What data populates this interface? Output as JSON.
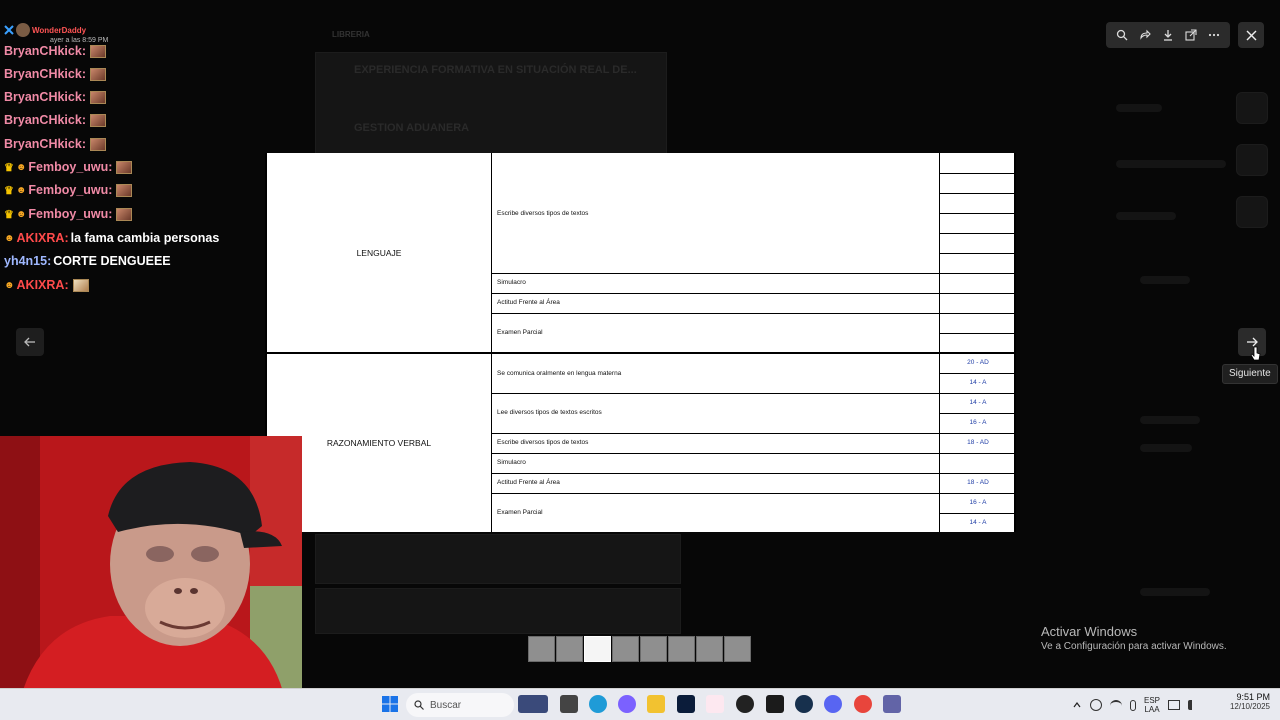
{
  "chat": {
    "header_name": "WonderDaddy",
    "header_time": "ayer a las 8:59 PM",
    "messages": [
      {
        "user": "BryanCHkick:",
        "text": "",
        "color": "pink"
      },
      {
        "user": "BryanCHkick:",
        "text": "",
        "color": "pink"
      },
      {
        "user": "BryanCHkick:",
        "text": "",
        "color": "pink"
      },
      {
        "user": "BryanCHkick:",
        "text": "",
        "color": "pink"
      },
      {
        "user": "BryanCHkick:",
        "text": "",
        "color": "pink"
      },
      {
        "user": "Femboy_uwu:",
        "text": "",
        "color": "pink"
      },
      {
        "user": "Femboy_uwu:",
        "text": "",
        "color": "pink"
      },
      {
        "user": "Femboy_uwu:",
        "text": "",
        "color": "pink"
      },
      {
        "user": "AKIXRA:",
        "text": "la fama cambia personas",
        "color": "red"
      },
      {
        "user": "yh4n15:",
        "text": "CORTE DENGUEEE",
        "color": "blue"
      },
      {
        "user": "AKIXRA:",
        "text": "",
        "color": "red"
      }
    ]
  },
  "viewer": {
    "next_tooltip": "Siguiente",
    "thumbnail_count": 8,
    "active_thumbnail": 3
  },
  "document": {
    "sections": [
      {
        "area": "LENGUAJE",
        "rows": [
          {
            "competency": "Escribe diversos tipos de textos",
            "grades": [
              "",
              "",
              "",
              "",
              "",
              ""
            ]
          },
          {
            "competency": "Simulacro",
            "grades": [
              ""
            ]
          },
          {
            "competency": "Actitud Frente al Área",
            "grades": [
              ""
            ]
          },
          {
            "competency": "Examen Parcial",
            "grades": [
              "",
              ""
            ]
          }
        ]
      },
      {
        "area": "RAZONAMIENTO VERBAL",
        "rows": [
          {
            "competency": "Se comunica oralmente en lengua materna",
            "grades": [
              "20 - AD",
              "14 - A"
            ]
          },
          {
            "competency": "Lee diversos tipos de textos escritos",
            "grades": [
              "14 - A",
              "16 - A"
            ]
          },
          {
            "competency": "Escribe diversos tipos de textos",
            "grades": [
              "18 - AD"
            ]
          },
          {
            "competency": "Simulacro",
            "grades": [
              ""
            ]
          },
          {
            "competency": "Actitud Frente al Área",
            "grades": [
              "18 - AD"
            ]
          },
          {
            "competency": "Examen Parcial",
            "grades": [
              "16 - A",
              "14 - A"
            ]
          }
        ]
      }
    ]
  },
  "background": {
    "card_title_1": "EXPERIENCIA FORMATIVA EN SITUACIÓN REAL DE...",
    "card_title_2": "GESTION ADUANERA",
    "channel_label": "LIBRERIA"
  },
  "watermark": {
    "title": "Activar Windows",
    "subtitle": "Ve a Configuración para activar Windows."
  },
  "taskbar": {
    "search_placeholder": "Buscar",
    "lang_top": "ESP",
    "lang_bottom": "LAA",
    "time": "9:51 PM",
    "date": "12/10/2025"
  },
  "colors": {
    "grade_blue": "#1f3da6",
    "chat_pink": "#f08aa6",
    "chat_red": "#ff4b4b",
    "chat_blue": "#9fb8ff"
  }
}
